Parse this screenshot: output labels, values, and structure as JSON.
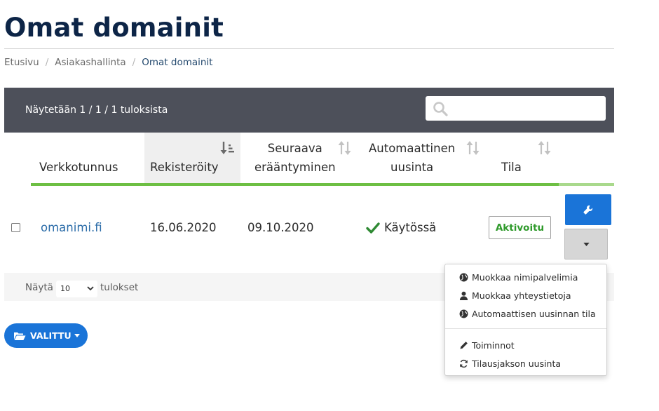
{
  "page": {
    "title": "Omat domainit"
  },
  "breadcrumb": {
    "items": [
      "Etusivu",
      "Asiakashallinta",
      "Omat domainit"
    ],
    "separator": "/"
  },
  "toolbar": {
    "result_count": "Näytetään 1 / 1 / 1 tuloksista",
    "search_value": "",
    "search_placeholder": ""
  },
  "table": {
    "columns": [
      {
        "line1": "",
        "line2": "Verkkotunnus",
        "sort": "none"
      },
      {
        "line1": "",
        "line2": "Rekisteröity",
        "sort": "active"
      },
      {
        "line1": "Seuraava",
        "line2": "erääntyminen",
        "sort": "neutral"
      },
      {
        "line1": "Automaattinen",
        "line2": "uusinta",
        "sort": "neutral"
      },
      {
        "line1": "",
        "line2": "Tila",
        "sort": "neutral"
      }
    ],
    "rows": [
      {
        "domain": "omanimi.fi",
        "registered": "16.06.2020",
        "expires": "09.10.2020",
        "auto_renew": "Käytössä",
        "status": "Aktivoitu"
      }
    ]
  },
  "footer": {
    "show_label": "Näytä",
    "page_size": "10",
    "results_label": "tulokset"
  },
  "dropdown": {
    "items": [
      {
        "label": "Muokkaa nimipalvelimia",
        "icon": "globe-icon"
      },
      {
        "label": "Muokkaa yhteystietoja",
        "icon": "user-icon"
      },
      {
        "label": "Automaattisen uusinnan tila",
        "icon": "globe-icon"
      },
      {
        "label": "Toiminnot",
        "icon": "pencil-icon"
      },
      {
        "label": "Tilausjakson uusinta",
        "icon": "refresh-icon"
      }
    ]
  },
  "bulk": {
    "label": "VALITTU"
  },
  "colors": {
    "title": "#0d2547",
    "toolbar_bg": "#4d505a",
    "accent_green": "#6dbf43",
    "primary_blue": "#1a74d8",
    "link_blue": "#2b6ca8",
    "status_green": "#2f9a2b"
  }
}
